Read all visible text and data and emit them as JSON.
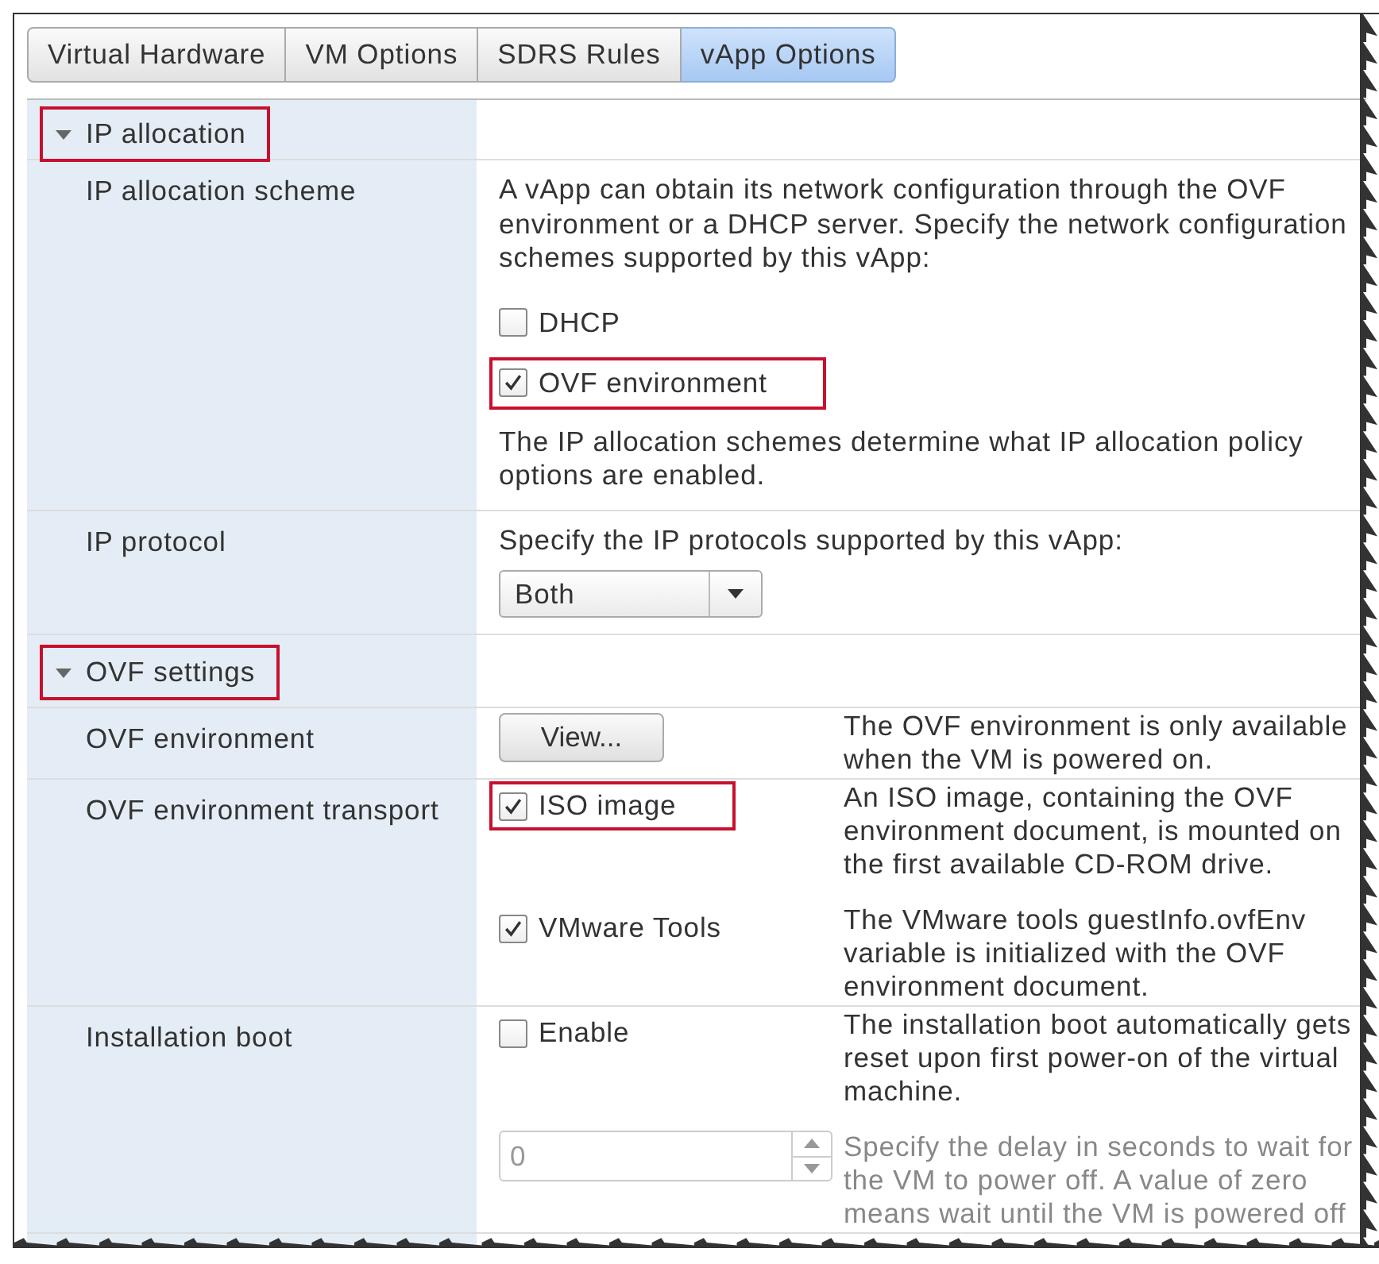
{
  "tabs": [
    {
      "label": "Virtual Hardware",
      "selected": false
    },
    {
      "label": "VM Options",
      "selected": false
    },
    {
      "label": "SDRS Rules",
      "selected": false
    },
    {
      "label": "vApp Options",
      "selected": true
    }
  ],
  "sections": [
    {
      "title": "IP allocation",
      "expanded": true,
      "highlighted": true,
      "rows": [
        {
          "label": "IP allocation scheme",
          "items": [
            {
              "kind": "text",
              "text": "A vApp can obtain its network configuration through the OVF environment or a DHCP server. Specify the network configuration schemes supported by this vApp:"
            },
            {
              "kind": "checkbox",
              "label": "DHCP",
              "checked": false,
              "highlighted": false
            },
            {
              "kind": "checkbox",
              "label": "OVF environment",
              "checked": true,
              "highlighted": true
            },
            {
              "kind": "text",
              "text": "The IP allocation schemes determine what IP allocation policy options are enabled."
            }
          ]
        },
        {
          "label": "IP protocol",
          "items": [
            {
              "kind": "text",
              "text": "Specify the IP protocols supported by this vApp:"
            },
            {
              "kind": "select",
              "value": "Both"
            }
          ]
        }
      ]
    },
    {
      "title": "OVF settings",
      "expanded": true,
      "highlighted": true,
      "rows": [
        {
          "label": "OVF environment",
          "items": [
            {
              "kind": "button",
              "label": "View...",
              "note": "The OVF environment is only available when the VM is powered on."
            }
          ]
        },
        {
          "label": "OVF environment transport",
          "items": [
            {
              "kind": "checkbox",
              "label": "ISO image",
              "checked": true,
              "highlighted": true,
              "note": "An ISO image, containing the OVF environment document, is mounted on the first available CD-ROM drive."
            },
            {
              "kind": "checkbox",
              "label": "VMware Tools",
              "checked": true,
              "highlighted": false,
              "note": "The VMware tools guestInfo.ovfEnv variable is initialized with the OVF environment document."
            }
          ]
        },
        {
          "label": "Installation boot",
          "items": [
            {
              "kind": "checkbox",
              "label": "Enable",
              "checked": false,
              "highlighted": false,
              "note": "The installation boot automatically gets reset upon first power-on of the virtual machine."
            },
            {
              "kind": "spinner",
              "value": "0",
              "disabled": true,
              "note": "Specify the delay in seconds to wait for the VM to power off. A value of zero means wait until the VM is powered off"
            }
          ]
        }
      ]
    }
  ]
}
